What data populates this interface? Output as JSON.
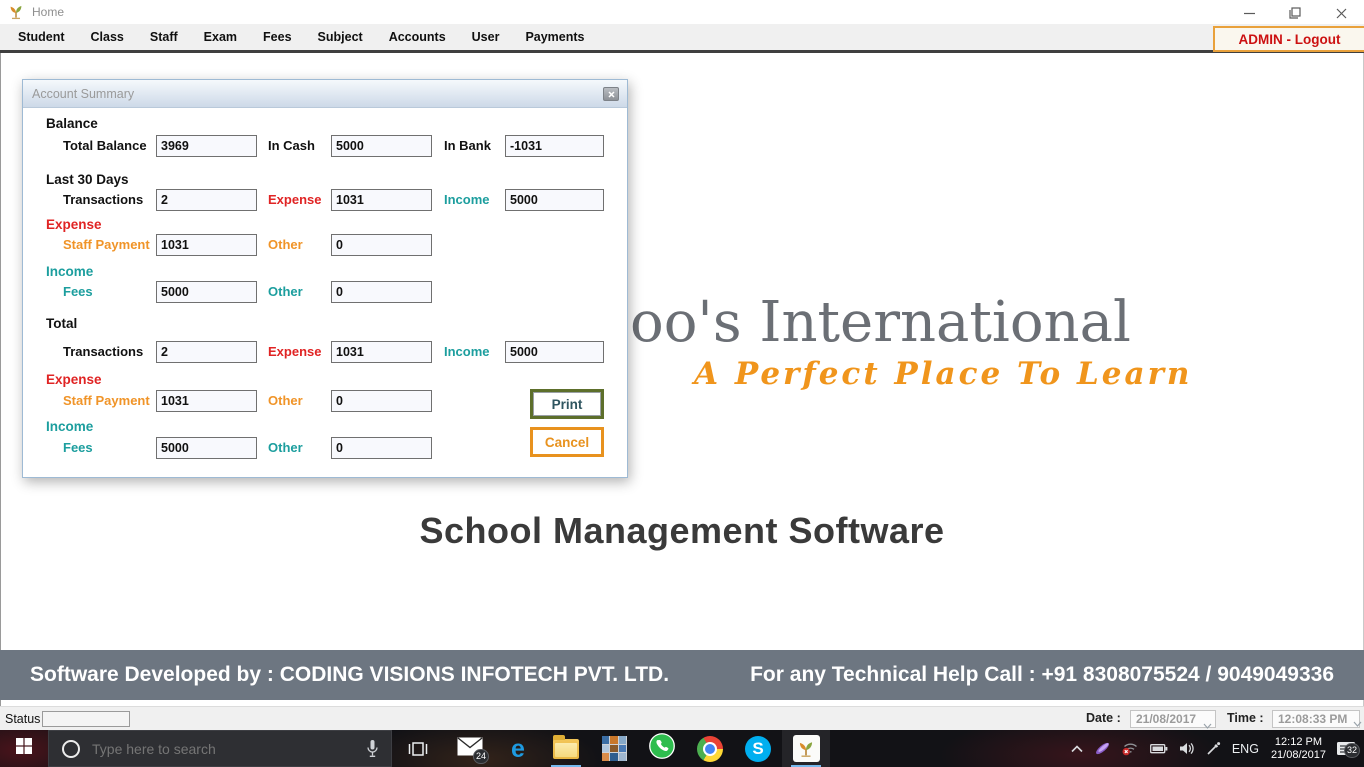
{
  "window": {
    "title": "Home"
  },
  "menu": {
    "items": [
      "Student",
      "Class",
      "Staff",
      "Exam",
      "Fees",
      "Subject",
      "Accounts",
      "User",
      "Payments"
    ],
    "logout_label": "ADMIN - Logout"
  },
  "dialog": {
    "title": "Account Summary",
    "balance": {
      "heading": "Balance",
      "total_label": "Total Balance",
      "total_value": "3969",
      "cash_label": "In Cash",
      "cash_value": "5000",
      "bank_label": "In Bank",
      "bank_value": "-1031"
    },
    "last30": {
      "heading": "Last 30 Days",
      "transactions_label": "Transactions",
      "transactions_value": "2",
      "expense_label": "Expense",
      "expense_value": "1031",
      "income_label": "Income",
      "income_value": "5000",
      "expense_heading": "Expense",
      "staff_payment_label": "Staff Payment",
      "staff_payment_value": "1031",
      "expense_other_label": "Other",
      "expense_other_value": "0",
      "income_heading": "Income",
      "fees_label": "Fees",
      "fees_value": "5000",
      "income_other_label": "Other",
      "income_other_value": "0"
    },
    "total": {
      "heading": "Total",
      "transactions_label": "Transactions",
      "transactions_value": "2",
      "expense_label": "Expense",
      "expense_value": "1031",
      "income_label": "Income",
      "income_value": "5000",
      "expense_heading": "Expense",
      "staff_payment_label": "Staff Payment",
      "staff_payment_value": "1031",
      "expense_other_label": "Other",
      "expense_other_value": "0",
      "income_heading": "Income",
      "fees_label": "Fees",
      "fees_value": "5000",
      "income_other_label": "Other",
      "income_other_value": "0"
    },
    "print_label": "Print",
    "cancel_label": "Cancel"
  },
  "branding": {
    "logo_text": "oo's International",
    "tagline": "A Perfect Place To Learn",
    "product_title": "School Management Software"
  },
  "footer": {
    "developer_text": "Software Developed by : CODING VISIONS INFOTECH PVT. LTD.",
    "help_text": "For any Technical Help Call : +91 8308075524 / 9049049336"
  },
  "statusbar": {
    "status_label": "Status",
    "date_label": "Date :",
    "date_value": "21/08/2017",
    "time_label": "Time :",
    "time_value": "12:08:33 PM"
  },
  "taskbar": {
    "search_placeholder": "Type here to search",
    "mail_badge": "24",
    "edge_glyph": "e",
    "skype_glyph": "S",
    "language": "ENG",
    "clock_time": "12:12 PM",
    "clock_date": "21/08/2017",
    "notification_badge": "32"
  },
  "colors": {
    "accent_orange": "#F09428",
    "expense_red": "#E02424",
    "income_teal": "#1C9E9E",
    "logout_red": "#CC1111",
    "footer_slate": "#6D7681",
    "print_border_olive": "#5D6F2B",
    "taskbar_underline_blue": "#76B9ED"
  }
}
